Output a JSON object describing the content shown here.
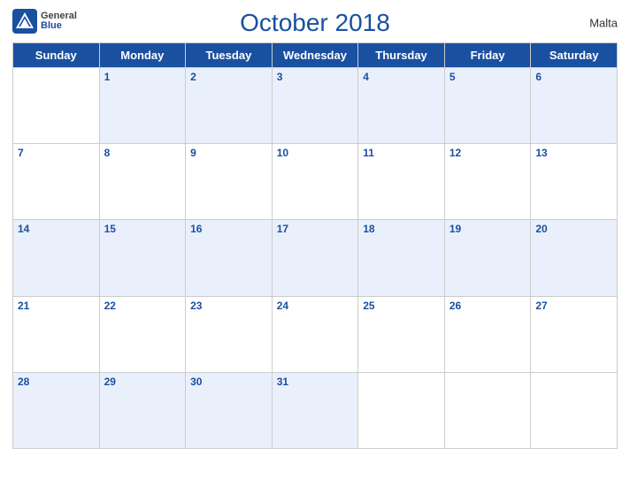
{
  "header": {
    "title": "October 2018",
    "country": "Malta",
    "logo_general": "General",
    "logo_blue": "Blue"
  },
  "days_of_week": [
    "Sunday",
    "Monday",
    "Tuesday",
    "Wednesday",
    "Thursday",
    "Friday",
    "Saturday"
  ],
  "weeks": [
    [
      null,
      1,
      2,
      3,
      4,
      5,
      6
    ],
    [
      7,
      8,
      9,
      10,
      11,
      12,
      13
    ],
    [
      14,
      15,
      16,
      17,
      18,
      19,
      20
    ],
    [
      21,
      22,
      23,
      24,
      25,
      26,
      27
    ],
    [
      28,
      29,
      30,
      31,
      null,
      null,
      null
    ]
  ]
}
